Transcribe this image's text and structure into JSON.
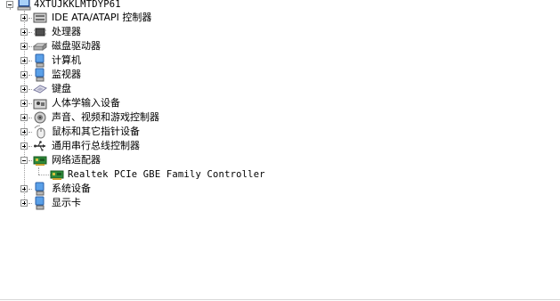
{
  "device_tree": {
    "root": {
      "label": "4XTUJKKLMTDYP61",
      "icon": "computer-icon",
      "expanded": true
    },
    "categories": [
      {
        "label": "IDE ATA/ATAPI 控制器",
        "icon": "ide-controller-icon",
        "expanded": false
      },
      {
        "label": "处理器",
        "icon": "processor-icon",
        "expanded": false
      },
      {
        "label": "磁盘驱动器",
        "icon": "disk-drive-icon",
        "expanded": false
      },
      {
        "label": "计算机",
        "icon": "computer-icon",
        "expanded": false
      },
      {
        "label": "监视器",
        "icon": "monitor-icon",
        "expanded": false
      },
      {
        "label": "键盘",
        "icon": "keyboard-icon",
        "expanded": false
      },
      {
        "label": "人体学输入设备",
        "icon": "hid-icon",
        "expanded": false
      },
      {
        "label": "声音、视频和游戏控制器",
        "icon": "sound-icon",
        "expanded": false
      },
      {
        "label": "鼠标和其它指针设备",
        "icon": "mouse-icon",
        "expanded": false
      },
      {
        "label": "通用串行总线控制器",
        "icon": "usb-icon",
        "expanded": false
      },
      {
        "label": "网络适配器",
        "icon": "network-adapter-icon",
        "expanded": true
      },
      {
        "label": "系统设备",
        "icon": "system-device-icon",
        "expanded": false
      },
      {
        "label": "显示卡",
        "icon": "display-adapter-icon",
        "expanded": false
      }
    ],
    "network_children": [
      {
        "label": "Realtek PCIe GBE Family Controller",
        "icon": "network-adapter-icon"
      }
    ]
  }
}
